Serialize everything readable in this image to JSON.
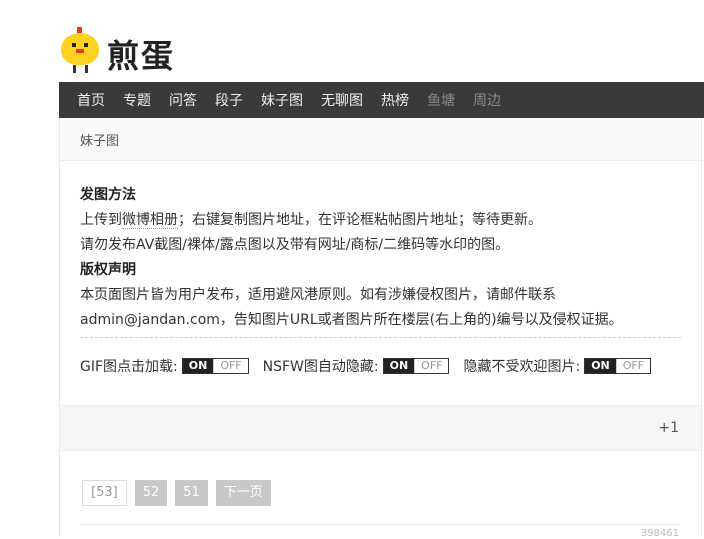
{
  "brand": {
    "name": "煎蛋"
  },
  "nav": {
    "items": [
      "首页",
      "专题",
      "问答",
      "段子",
      "妹子图",
      "无聊图",
      "热榜"
    ],
    "dim_items": [
      "鱼塘",
      "周边"
    ]
  },
  "breadcrumb": "妹子图",
  "notice": {
    "post_title": "发图方法",
    "line1_pre": "上传到",
    "line1_link": "微博相册",
    "line1_post": "；右键复制图片地址，在评论框粘帖图片地址；等待更新。",
    "line2": "请勿发布AV截图/裸体/露点图以及带有网址/商标/二维码等水印的图。",
    "copyright_title": "版权声明",
    "line3": "本页面图片皆为用户发布，适用避风港原则。如有涉嫌侵权图片，请邮件联系",
    "line4": "admin@jandan.com，告知图片URL或者图片所在楼层(右上角的)编号以及侵权证据。"
  },
  "toggles": [
    {
      "label": "GIF图点击加载:",
      "on": "ON",
      "off": "OFF"
    },
    {
      "label": "NSFW图自动隐藏:",
      "on": "ON",
      "off": "OFF"
    },
    {
      "label": "隐藏不受欢迎图片:",
      "on": "ON",
      "off": "OFF"
    }
  ],
  "vote": {
    "plus_one": "+1"
  },
  "pager": {
    "current": "[53]",
    "p52": "52",
    "p51": "51",
    "next": "下一页"
  },
  "bottom_number": "398461"
}
